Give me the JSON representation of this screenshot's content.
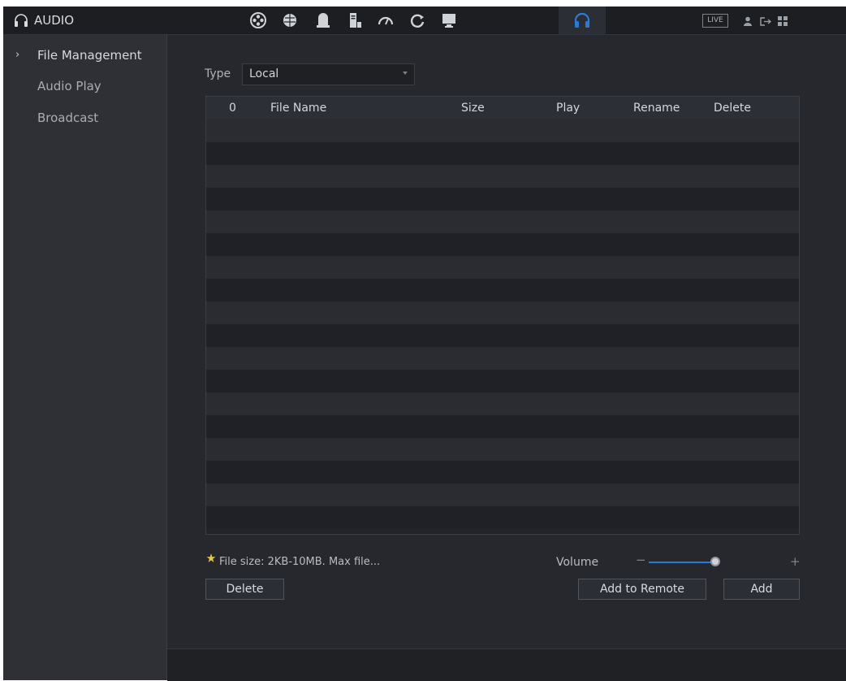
{
  "app": {
    "title": "AUDIO"
  },
  "topbar": {
    "icons": [
      "camera-icon",
      "network-icon",
      "storage-icon",
      "system-icon",
      "performance-icon",
      "maintenance-icon",
      "display-icon",
      "audio-icon"
    ],
    "active_icon": "audio-icon",
    "live_label": "LIVE",
    "right_icons": [
      "user-icon",
      "logout-icon",
      "grid-icon"
    ]
  },
  "sidebar": {
    "items": [
      {
        "label": "File Management",
        "active": true
      },
      {
        "label": "Audio Play",
        "active": false
      },
      {
        "label": "Broadcast",
        "active": false
      }
    ]
  },
  "filter": {
    "type_label": "Type",
    "type_value": "Local"
  },
  "table": {
    "columns": [
      "0",
      "File Name",
      "Size",
      "Play",
      "Rename",
      "Delete"
    ],
    "rows": []
  },
  "hint": {
    "text": "File size: 2KB-10MB. Max file..."
  },
  "volume": {
    "label": "Volume",
    "minus": "−",
    "plus": "+",
    "level": 1.0
  },
  "buttons": {
    "delete_label": "Delete",
    "add_remote_label": "Add to Remote",
    "add_label": "Add"
  },
  "colors": {
    "accent": "#2a7bd8",
    "panel": "#26282d",
    "sidebar": "#2e3035"
  }
}
